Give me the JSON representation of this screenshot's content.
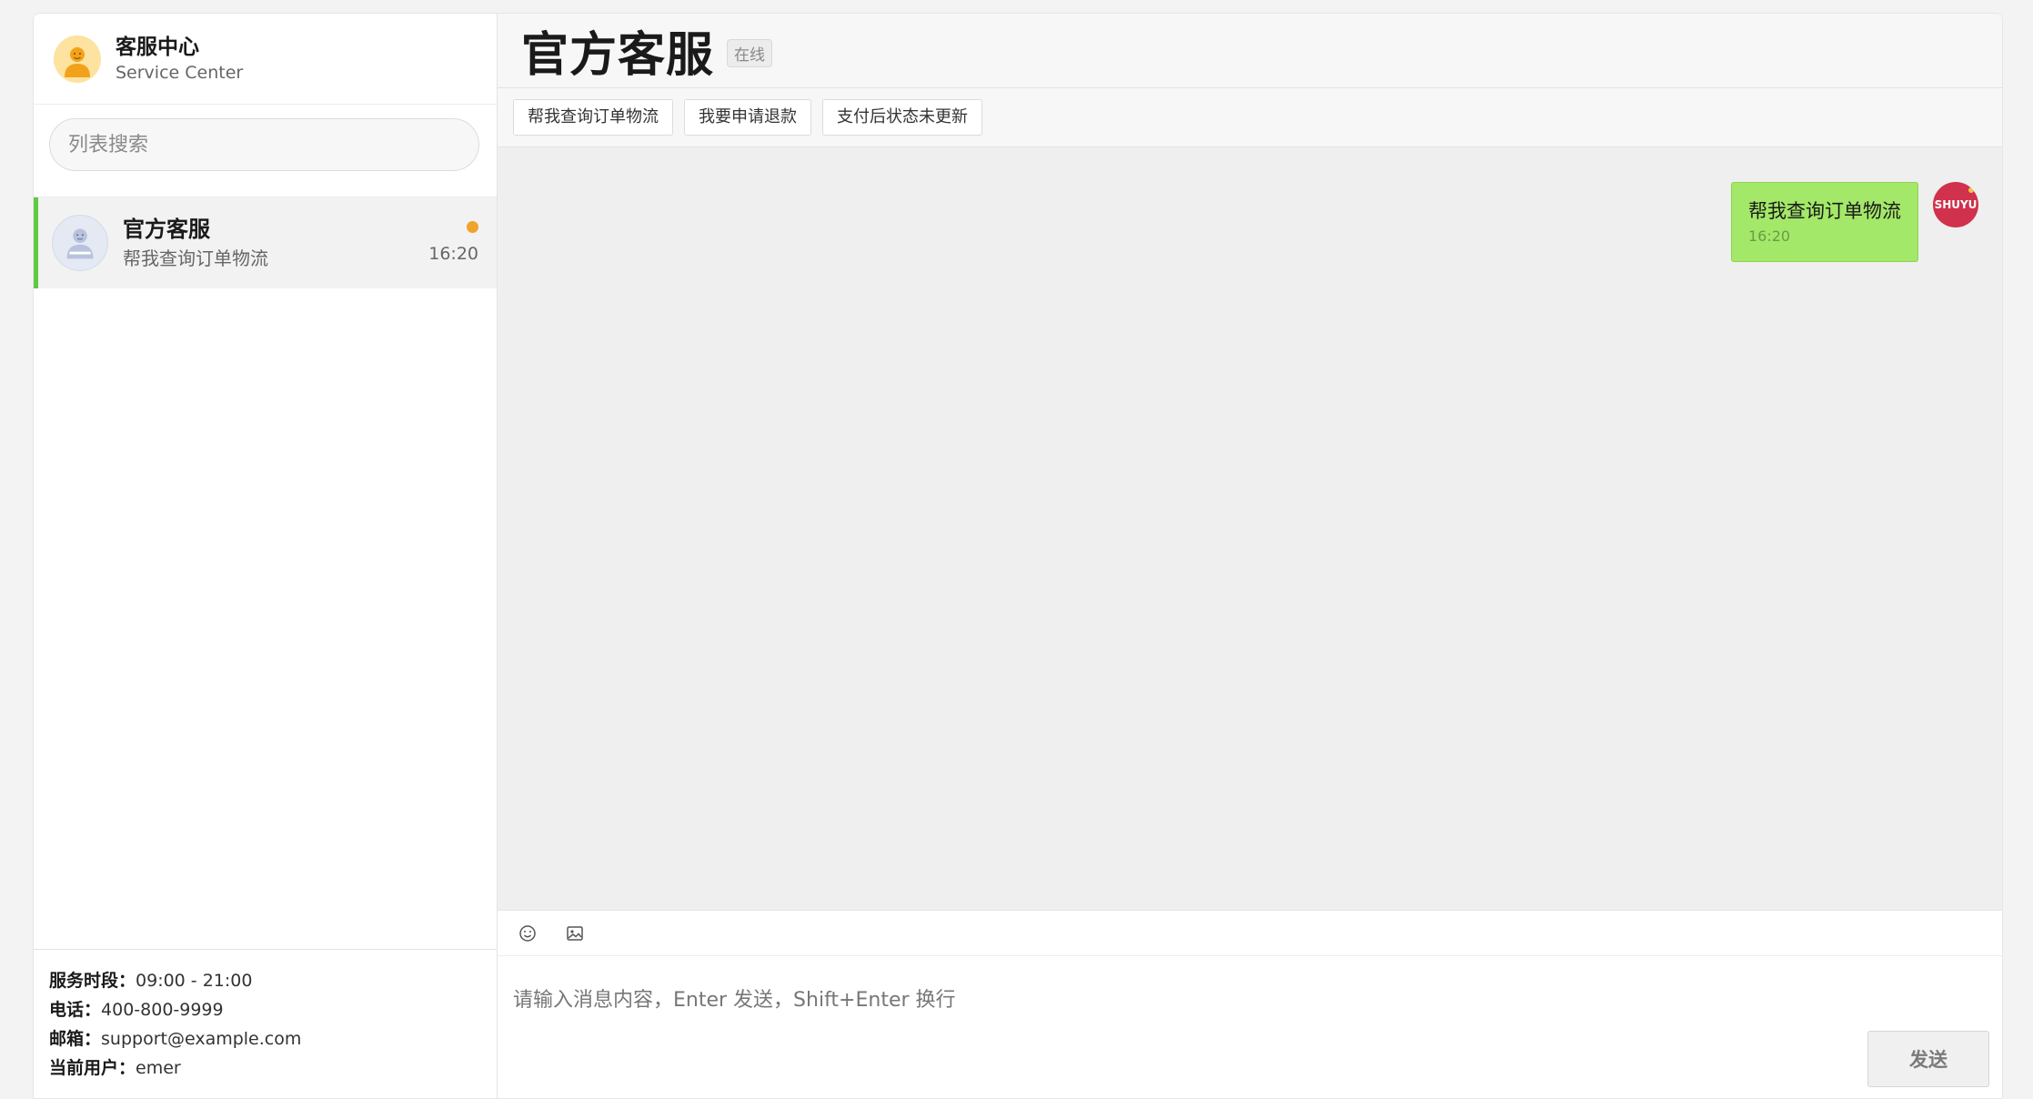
{
  "sidebar": {
    "brand": {
      "title": "客服中心",
      "subtitle": "Service Center",
      "avatar_icon": "support-agent-icon"
    },
    "search": {
      "placeholder": "列表搜索",
      "value": ""
    },
    "conversations": [
      {
        "name": "官方客服",
        "preview": "帮我查询订单物流",
        "time": "16:20",
        "unread": true,
        "active": true,
        "avatar_icon": "user-icon"
      }
    ],
    "info": {
      "hours_label": "服务时段：",
      "hours_value": "09:00 - 21:00",
      "phone_label": "电话：",
      "phone_value": "400-800-9999",
      "email_label": "邮箱：",
      "email_value": "support@example.com",
      "user_label": "当前用户：",
      "user_value": "emer"
    }
  },
  "chat": {
    "title": "官方客服",
    "status": "在线",
    "quick_replies": [
      "帮我查询订单物流",
      "我要申请退款",
      "支付后状态未更新"
    ],
    "messages": [
      {
        "from": "me",
        "text": "帮我查询订单物流",
        "time": "16:20",
        "avatar_text": "SHUYU"
      }
    ],
    "composer": {
      "placeholder": "请输入消息内容，Enter 发送，Shift+Enter 换行",
      "value": "",
      "send_label": "发送",
      "tools": [
        "emoji-icon",
        "image-icon"
      ]
    }
  },
  "colors": {
    "accent_green": "#5fc941",
    "bubble_green": "#a3e868",
    "unread_dot": "#f0a32a",
    "user_avatar": "#d0314c"
  }
}
